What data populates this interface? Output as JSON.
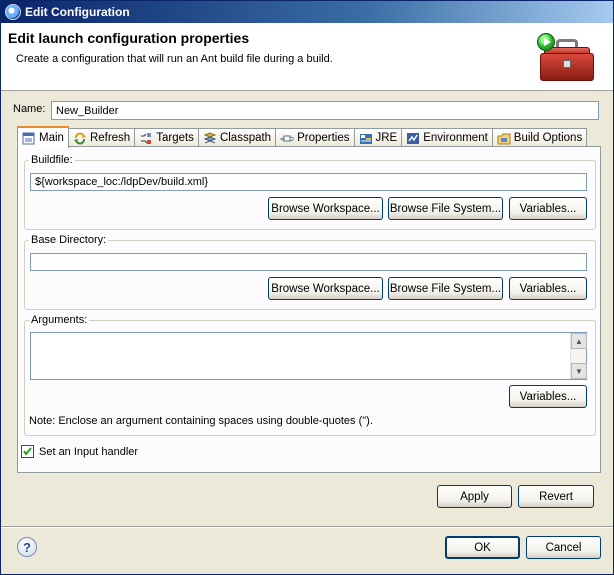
{
  "window": {
    "title": "Edit Configuration"
  },
  "header": {
    "title": "Edit launch configuration properties",
    "subtitle": "Create a configuration that will run an Ant build file during a build."
  },
  "name": {
    "label": "Name:",
    "value": "New_Builder"
  },
  "tabs": [
    {
      "label": "Main",
      "icon": "main-tab-icon"
    },
    {
      "label": "Refresh",
      "icon": "refresh-icon"
    },
    {
      "label": "Targets",
      "icon": "targets-icon"
    },
    {
      "label": "Classpath",
      "icon": "classpath-icon"
    },
    {
      "label": "Properties",
      "icon": "properties-icon"
    },
    {
      "label": "JRE",
      "icon": "jre-icon"
    },
    {
      "label": "Environment",
      "icon": "environment-icon"
    },
    {
      "label": "Build Options",
      "icon": "build-options-icon"
    }
  ],
  "buildfile": {
    "label": "Buildfile:",
    "value": "${workspace_loc:/ldpDev/build.xml}",
    "browse_workspace": "Browse Workspace...",
    "browse_file_system": "Browse File System...",
    "variables": "Variables..."
  },
  "base_directory": {
    "label": "Base Directory:",
    "value": "",
    "browse_workspace": "Browse Workspace...",
    "browse_file_system": "Browse File System...",
    "variables": "Variables..."
  },
  "arguments": {
    "label": "Arguments:",
    "value": "",
    "variables": "Variables...",
    "note": "Note: Enclose an argument containing spaces using double-quotes (\")."
  },
  "input_handler": {
    "label": "Set an Input handler",
    "checked": true
  },
  "actions": {
    "apply": "Apply",
    "revert": "Revert",
    "ok": "OK",
    "cancel": "Cancel"
  },
  "colors": {
    "title_bar": "#0a246a",
    "tab_highlight": "#e68b2c"
  }
}
